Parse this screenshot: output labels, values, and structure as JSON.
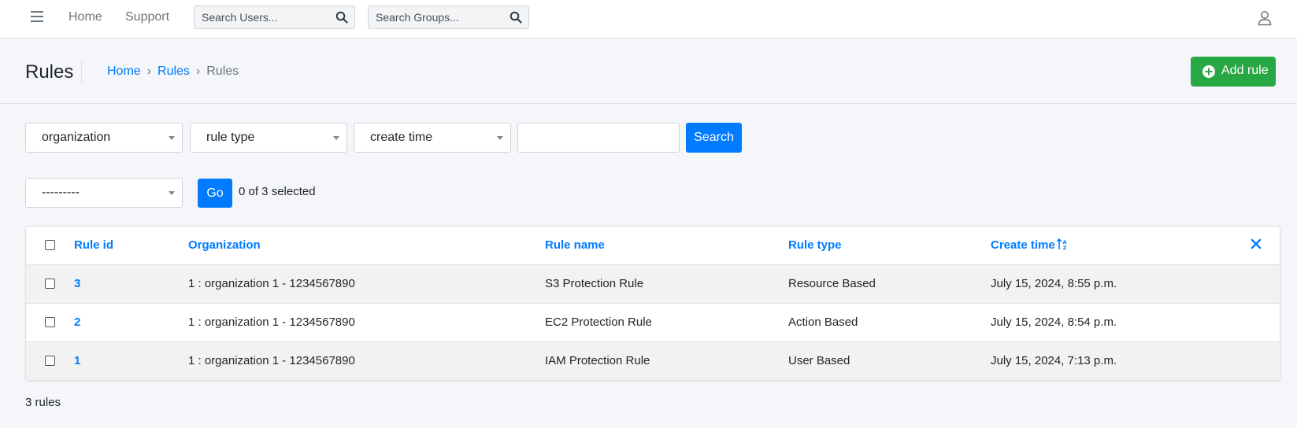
{
  "navbar": {
    "links": [
      "Home",
      "Support"
    ],
    "search_users_placeholder": "Search Users...",
    "search_groups_placeholder": "Search Groups..."
  },
  "header": {
    "title": "Rules",
    "breadcrumb": [
      "Home",
      "Rules",
      "Rules"
    ],
    "add_button": "Add rule"
  },
  "filters": {
    "organization": "organization",
    "rule_type": "rule type",
    "create_time": "create time",
    "search_value": "",
    "search_button": "Search"
  },
  "actions": {
    "action_select": "---------",
    "go_button": "Go",
    "selected_text": "0 of 3 selected"
  },
  "table": {
    "columns": [
      "Rule id",
      "Organization",
      "Rule name",
      "Rule type",
      "Create time"
    ],
    "rows": [
      {
        "id": "3",
        "organization": "1 : organization 1 - 1234567890",
        "name": "S3 Protection Rule",
        "type": "Resource Based",
        "created": "July 15, 2024, 8:55 p.m."
      },
      {
        "id": "2",
        "organization": "1 : organization 1 - 1234567890",
        "name": "EC2 Protection Rule",
        "type": "Action Based",
        "created": "July 15, 2024, 8:54 p.m."
      },
      {
        "id": "1",
        "organization": "1 : organization 1 - 1234567890",
        "name": "IAM Protection Rule",
        "type": "User Based",
        "created": "July 15, 2024, 7:13 p.m."
      }
    ]
  },
  "footer": {
    "count_text": "3 rules"
  },
  "colors": {
    "primary": "#007bff",
    "success": "#28a745",
    "background": "#f4f6f9"
  }
}
